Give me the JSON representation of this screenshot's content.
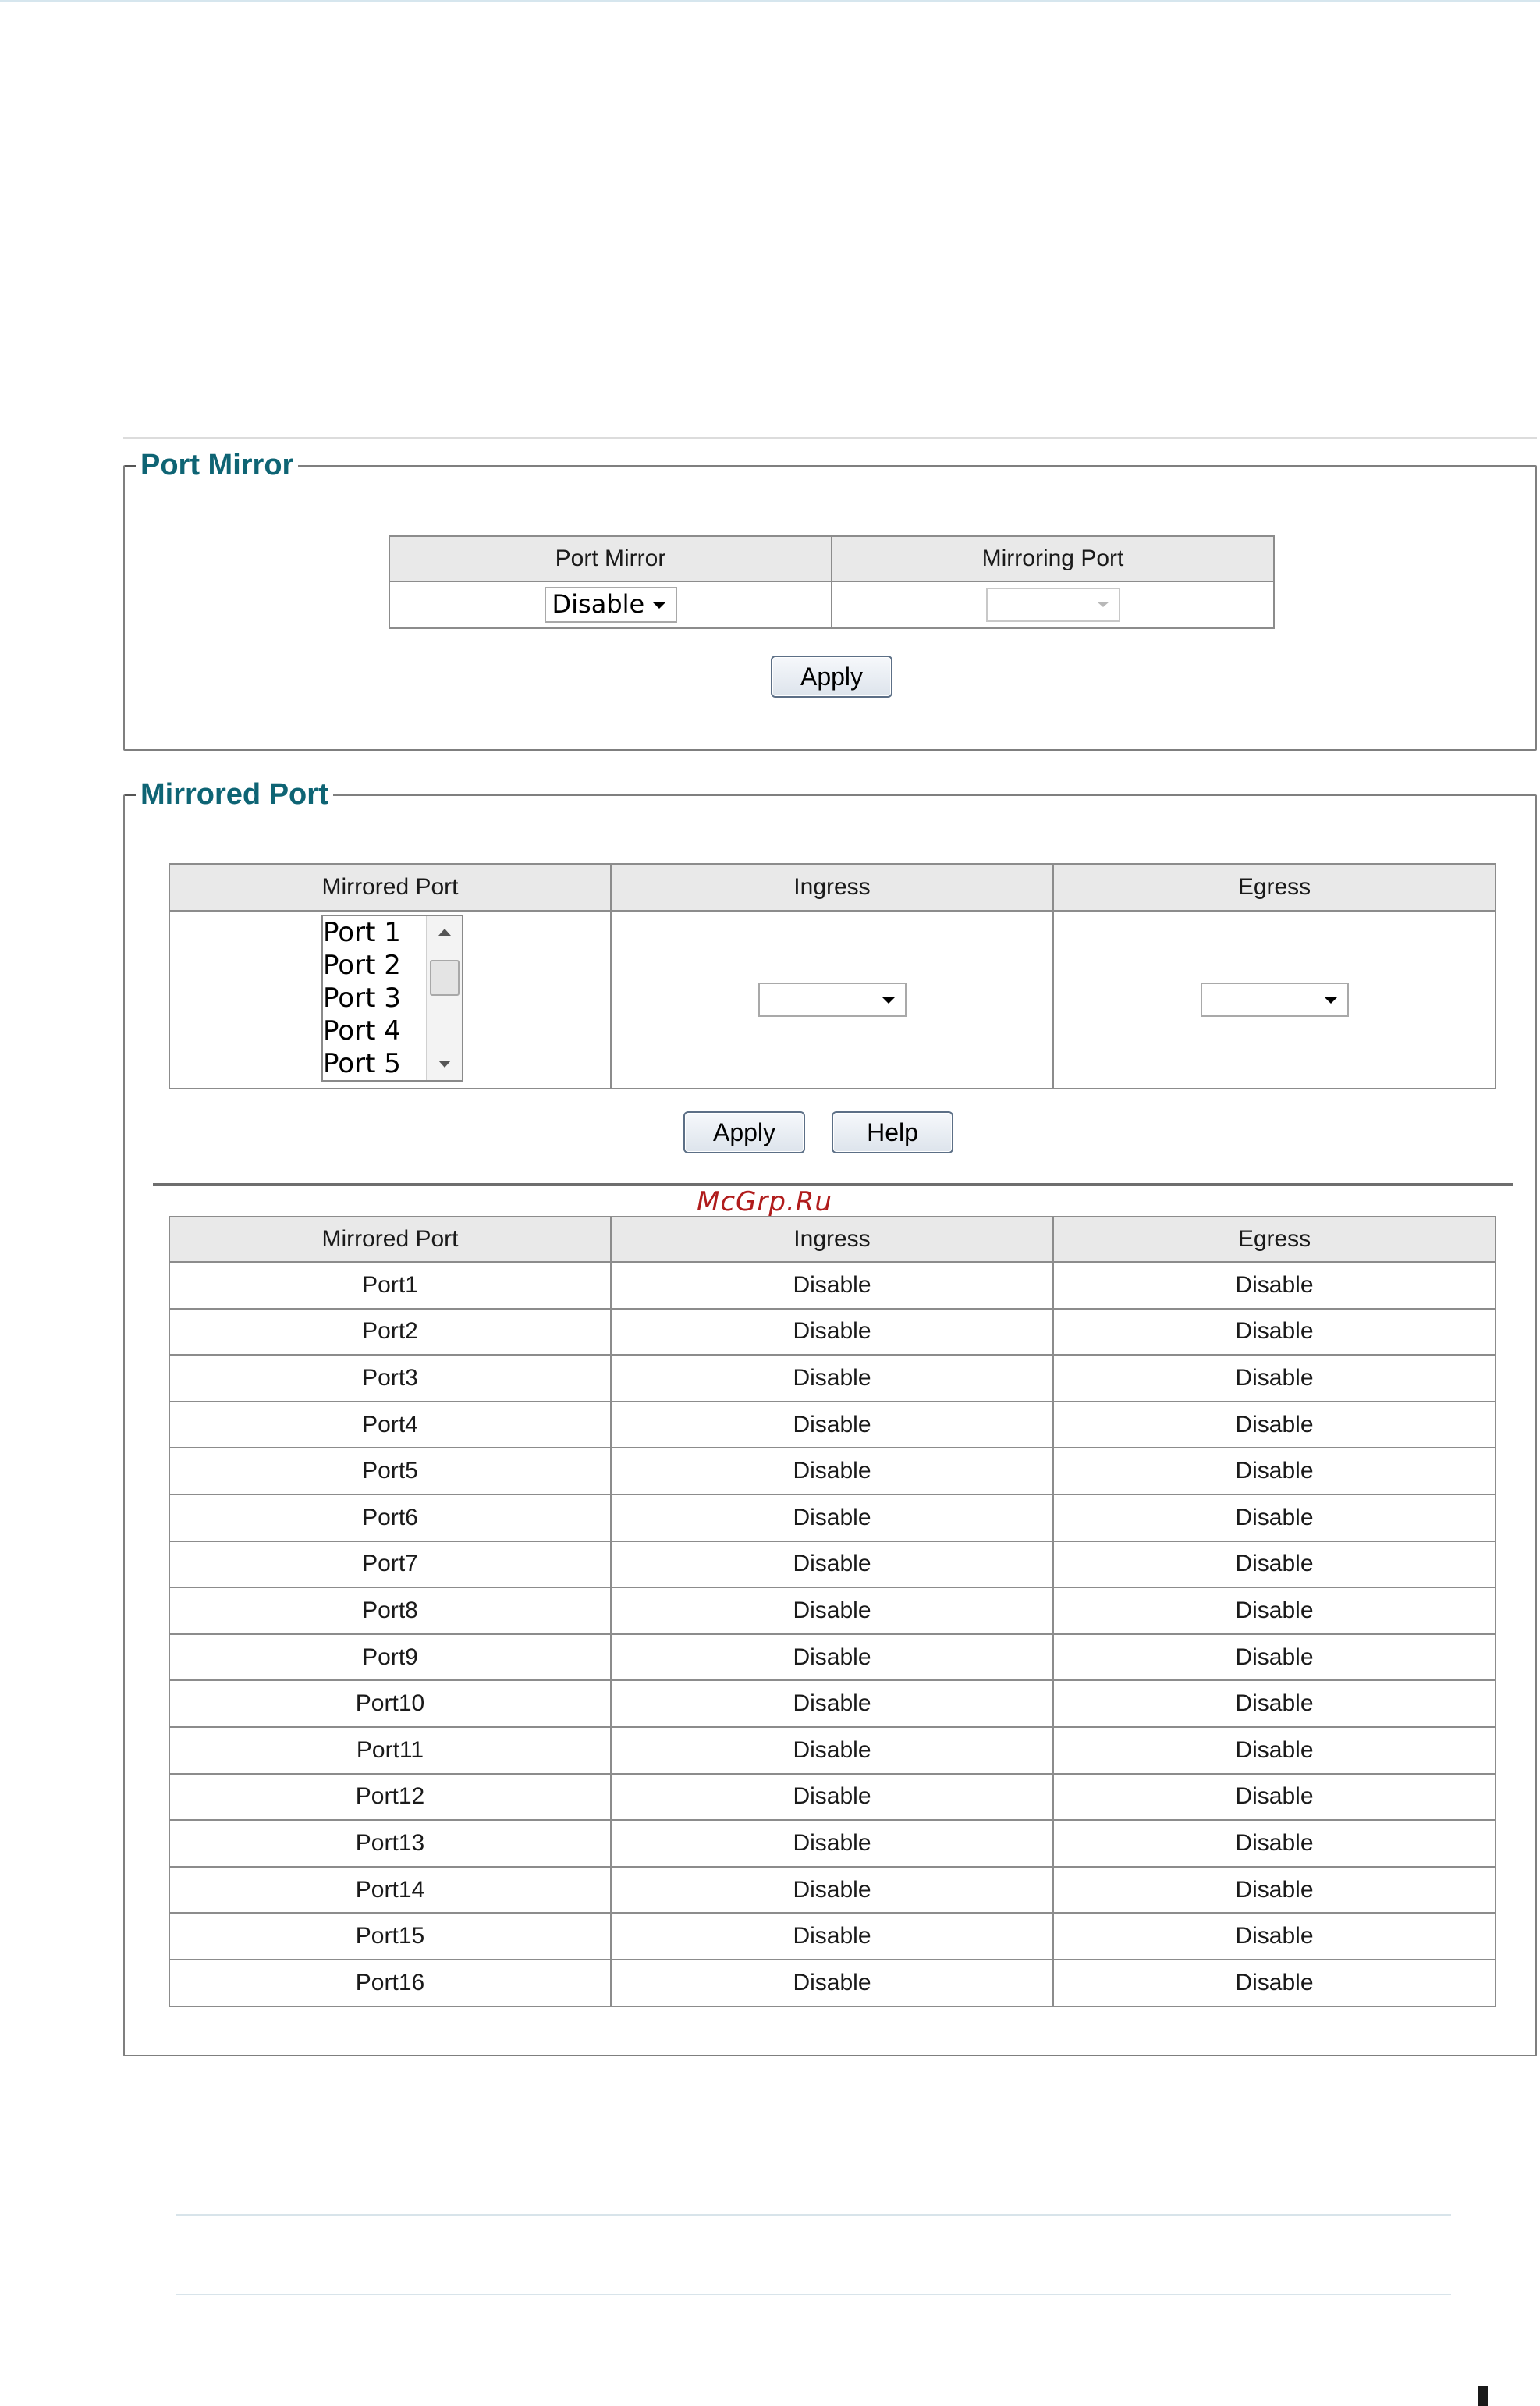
{
  "port_mirror": {
    "legend": "Port Mirror",
    "columns": [
      "Port Mirror",
      "Mirroring Port"
    ],
    "port_mirror_value": "Disable",
    "mirroring_port_value": "",
    "apply_label": "Apply"
  },
  "mirrored_port": {
    "legend": "Mirrored Port",
    "columns": [
      "Mirrored Port",
      "Ingress",
      "Egress"
    ],
    "port_list": [
      "Port 1",
      "Port 2",
      "Port 3",
      "Port 4",
      "Port 5"
    ],
    "ingress_value": "",
    "egress_value": "",
    "apply_label": "Apply",
    "help_label": "Help"
  },
  "watermark": "McGrp.Ru",
  "status_table": {
    "columns": [
      "Mirrored Port",
      "Ingress",
      "Egress"
    ],
    "rows": [
      [
        "Port1",
        "Disable",
        "Disable"
      ],
      [
        "Port2",
        "Disable",
        "Disable"
      ],
      [
        "Port3",
        "Disable",
        "Disable"
      ],
      [
        "Port4",
        "Disable",
        "Disable"
      ],
      [
        "Port5",
        "Disable",
        "Disable"
      ],
      [
        "Port6",
        "Disable",
        "Disable"
      ],
      [
        "Port7",
        "Disable",
        "Disable"
      ],
      [
        "Port8",
        "Disable",
        "Disable"
      ],
      [
        "Port9",
        "Disable",
        "Disable"
      ],
      [
        "Port10",
        "Disable",
        "Disable"
      ],
      [
        "Port11",
        "Disable",
        "Disable"
      ],
      [
        "Port12",
        "Disable",
        "Disable"
      ],
      [
        "Port13",
        "Disable",
        "Disable"
      ],
      [
        "Port14",
        "Disable",
        "Disable"
      ],
      [
        "Port15",
        "Disable",
        "Disable"
      ],
      [
        "Port16",
        "Disable",
        "Disable"
      ]
    ]
  }
}
